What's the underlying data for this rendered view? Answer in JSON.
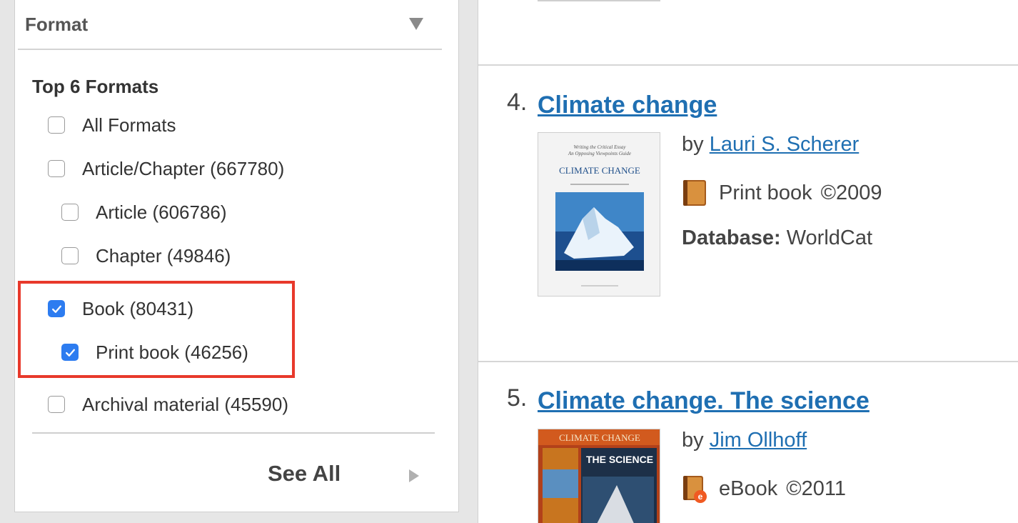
{
  "facet": {
    "title": "Format",
    "subtitle": "Top 6 Formats",
    "options": [
      {
        "label": "All Formats",
        "checked": false
      },
      {
        "label": "Article/Chapter (667780)",
        "checked": false
      },
      {
        "label": "Article (606786)",
        "checked": false
      },
      {
        "label": "Chapter (49846)",
        "checked": false
      },
      {
        "label": "Book (80431)",
        "checked": true
      },
      {
        "label": "Print book (46256)",
        "checked": true
      },
      {
        "label": "Archival material (45590)",
        "checked": false
      }
    ],
    "see_all": "See All",
    "highlight_color": "#e8392b"
  },
  "results": [
    {
      "number": "4.",
      "title": "Climate change",
      "by": "by",
      "author": "Lauri S. Scherer",
      "format": "Print book",
      "year": "©2009",
      "database_label": "Database:",
      "database": "WorldCat",
      "cover_icon": "book-cover-image",
      "format_icon": "print-book-icon"
    },
    {
      "number": "5.",
      "title": "Climate change. The science",
      "by": "by",
      "author": "Jim Ollhoff",
      "format": "eBook",
      "year": "©2011",
      "cover_icon": "book-cover-image",
      "format_icon": "ebook-icon"
    }
  ],
  "colors": {
    "link": "#1f6fb2",
    "checkbox_checked": "#2d7cf0"
  }
}
